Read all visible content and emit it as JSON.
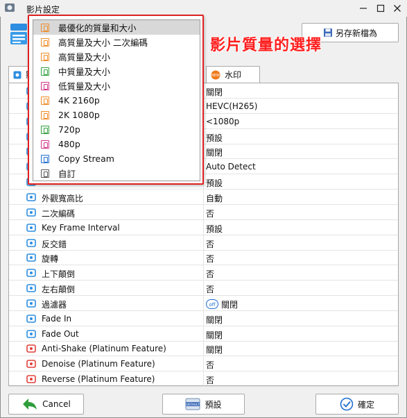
{
  "window": {
    "title": "影片設定"
  },
  "header": {
    "save_as_label": "另存新檔為"
  },
  "tabs": [
    {
      "label": "影"
    },
    {
      "label": "水印"
    }
  ],
  "rows": [
    {
      "label": "",
      "value": "關閉",
      "icon": "video-icon"
    },
    {
      "label": "",
      "value": "HEVC(H265)",
      "icon": "codec-icon"
    },
    {
      "label": "",
      "value": "<1080p",
      "icon": "resolution-icon"
    },
    {
      "label": "",
      "value": "預設",
      "icon": "bitrate-icon"
    },
    {
      "label": "",
      "value": "關閉",
      "icon": "settings-icon"
    },
    {
      "label": "",
      "value": "Auto Detect",
      "icon": "detect-icon"
    },
    {
      "label": "",
      "value": "預設",
      "icon": "framerate-icon"
    },
    {
      "label": "外觀寬高比",
      "value": "自動",
      "icon": "aspect-ratio-icon"
    },
    {
      "label": "二次編碼",
      "value": "否",
      "icon": "two-pass-icon"
    },
    {
      "label": "Key Frame Interval",
      "value": "預設",
      "icon": "keyframe-icon"
    },
    {
      "label": "反交錯",
      "value": "否",
      "icon": "deinterlace-icon"
    },
    {
      "label": "旋轉",
      "value": "否",
      "icon": "rotate-icon"
    },
    {
      "label": "上下顛倒",
      "value": "否",
      "icon": "flip-vertical-icon"
    },
    {
      "label": "左右顛倒",
      "value": "否",
      "icon": "flip-horizontal-icon"
    },
    {
      "label": "過濾器",
      "value": "關閉",
      "icon": "filter-icon",
      "badge": "off"
    },
    {
      "label": "Fade In",
      "value": "關閉",
      "icon": "fade-in-icon"
    },
    {
      "label": "Fade Out",
      "value": "關閉",
      "icon": "fade-out-icon"
    },
    {
      "label": "Anti-Shake (Platinum Feature)",
      "value": "關閉",
      "icon": "anti-shake-icon"
    },
    {
      "label": "Denoise (Platinum Feature)",
      "value": "否",
      "icon": "denoise-icon"
    },
    {
      "label": "Reverse (Platinum Feature)",
      "value": "否",
      "icon": "reverse-icon"
    }
  ],
  "dropdown": {
    "items": [
      {
        "label": "最優化的質量和大小",
        "color": "#f08a24",
        "selected": true
      },
      {
        "label": "高質量及大小 二次編碼",
        "color": "#f08a24"
      },
      {
        "label": "高質量及大小",
        "color": "#f08a24"
      },
      {
        "label": "中質量及大小",
        "color": "#2e9e3a"
      },
      {
        "label": "低質量及大小",
        "color": "#d0338c"
      },
      {
        "label": "4K 2160p",
        "color": "#f08a24"
      },
      {
        "label": "2K 1080p",
        "color": "#f08a24"
      },
      {
        "label": "720p",
        "color": "#2e9e3a"
      },
      {
        "label": "480p",
        "color": "#d0338c"
      },
      {
        "label": "Copy Stream",
        "color": "#1e6fd0"
      },
      {
        "label": "自訂",
        "color": "#555555"
      }
    ]
  },
  "annotation": "影片質量的選擇",
  "footer": {
    "cancel_label": "Cancel",
    "preset_label": "預設",
    "ok_label": "確定"
  },
  "colors": {
    "accent": "#1e6fd0",
    "annotation_red": "#ff1e1e"
  }
}
